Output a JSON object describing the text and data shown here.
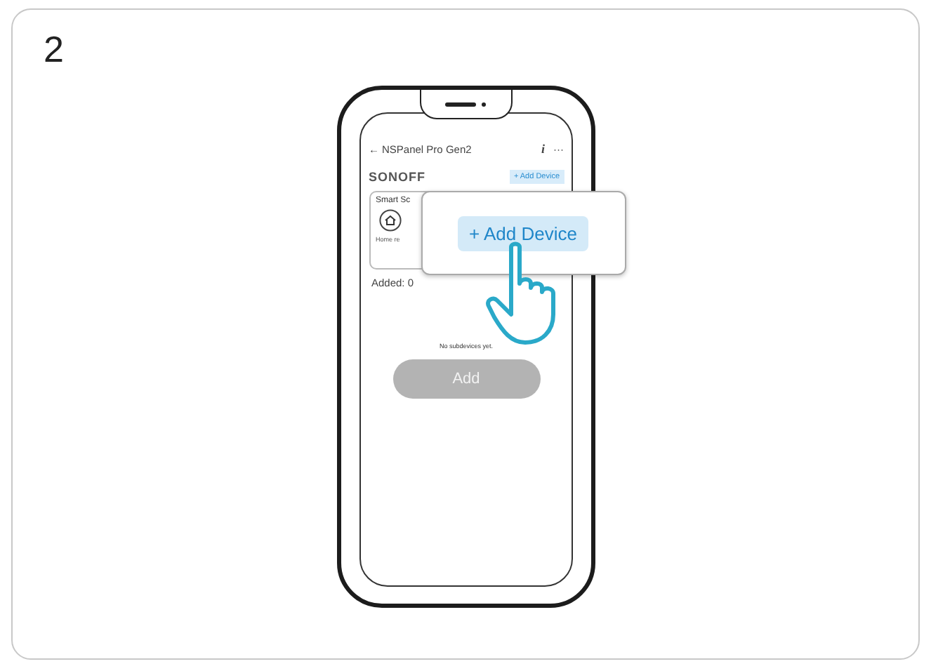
{
  "step": "2",
  "phone": {
    "header": {
      "back": "←",
      "title": "NSPanel Pro Gen2",
      "info": "i",
      "more": "···"
    },
    "brand": "SONOFF",
    "add_link": "+ Add Device",
    "scene_card": {
      "title": "Smart Sc",
      "item_label": "Home re"
    },
    "added": "Added: 0",
    "empty_message": "No subdevices yet.",
    "add_button": {
      "label": "Add",
      "disabled": true
    }
  },
  "callout": {
    "button": "+ Add Device"
  }
}
